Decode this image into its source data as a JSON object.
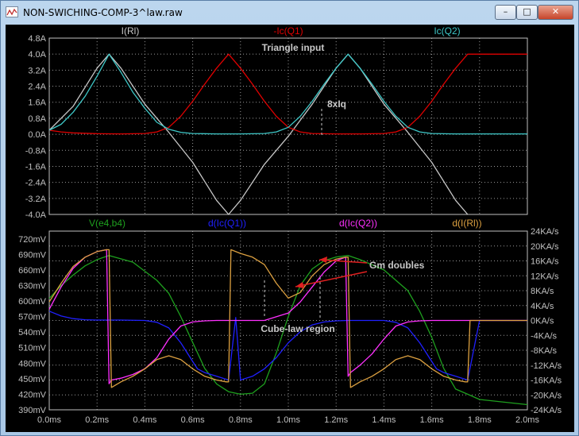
{
  "window": {
    "title": "NON-SWICHING-COMP-3^law.raw",
    "minimize": "–",
    "maximize": "□",
    "close": "✕"
  },
  "colors": {
    "white": "#c8c8c8",
    "red": "#e00000",
    "cyan": "#3ec8c8",
    "green": "#1ea01e",
    "blue": "#2020ff",
    "magenta": "#ff30ff",
    "orange": "#dca040",
    "grid": "#9a9a9a",
    "axis": "#c0c0c0"
  },
  "annotations": {
    "triangle": "Triangle input",
    "eightiq": "8xIq",
    "gm": "Gm doubles",
    "cube": "Cube-law region"
  },
  "chart_data": [
    {
      "type": "line",
      "xlim": [
        0,
        2.0
      ],
      "ylim": [
        -4.0,
        4.8
      ],
      "ytick_labels": [
        "4.8A",
        "4.0A",
        "3.2A",
        "2.4A",
        "1.6A",
        "0.8A",
        "0.0A",
        "-0.8A",
        "-1.6A",
        "-2.4A",
        "-3.2A",
        "-4.0A"
      ],
      "series": [
        {
          "name": "I(Rl)",
          "color": "white",
          "x": [
            0,
            0.1,
            0.2,
            0.25,
            0.3,
            0.4,
            0.5,
            0.6,
            0.7,
            0.75,
            0.8,
            0.9,
            1.0,
            1.1,
            1.2,
            1.25,
            1.3,
            1.4,
            1.5,
            1.6,
            1.7,
            1.75
          ],
          "y": [
            0.2,
            1.4,
            3.3,
            4.0,
            3.3,
            1.5,
            0.1,
            -1.4,
            -3.3,
            -4.0,
            -3.3,
            -1.5,
            -0.1,
            1.5,
            3.3,
            4.0,
            3.3,
            1.5,
            0.1,
            -1.4,
            -3.3,
            -4.0
          ]
        },
        {
          "name": "-Ic(Q1)",
          "color": "red",
          "x": [
            0,
            0.05,
            0.1,
            0.2,
            0.3,
            0.4,
            0.45,
            0.5,
            0.55,
            0.6,
            0.65,
            0.7,
            0.75,
            0.8,
            0.85,
            0.9,
            0.95,
            1.0,
            1.05,
            1.1,
            1.2,
            1.3,
            1.4,
            1.45,
            1.5,
            1.55,
            1.6,
            1.65,
            1.7,
            1.75,
            2.0
          ],
          "y": [
            0.2,
            0.12,
            0.07,
            0.03,
            0.02,
            0.04,
            0.12,
            0.35,
            0.9,
            1.65,
            2.5,
            3.3,
            4.0,
            3.3,
            2.5,
            1.65,
            0.9,
            0.35,
            0.12,
            0.04,
            0.02,
            0.02,
            0.04,
            0.12,
            0.35,
            0.9,
            1.65,
            2.5,
            3.3,
            4.0,
            4.0
          ]
        },
        {
          "name": "Ic(Q2)",
          "color": "cyan",
          "x": [
            0,
            0.05,
            0.1,
            0.15,
            0.2,
            0.25,
            0.3,
            0.35,
            0.4,
            0.45,
            0.5,
            0.55,
            0.6,
            0.7,
            0.8,
            0.9,
            0.95,
            1.0,
            1.05,
            1.1,
            1.15,
            1.2,
            1.25,
            1.3,
            1.35,
            1.4,
            1.45,
            1.5,
            1.55,
            1.6,
            1.7,
            2.0
          ],
          "y": [
            0.2,
            0.5,
            1.1,
            1.9,
            2.9,
            4.0,
            3.1,
            2.1,
            1.3,
            0.6,
            0.25,
            0.1,
            0.04,
            0.02,
            0.02,
            0.04,
            0.12,
            0.35,
            0.9,
            1.65,
            2.5,
            3.3,
            4.0,
            3.3,
            2.5,
            1.65,
            0.9,
            0.35,
            0.12,
            0.04,
            0.02,
            0.02
          ]
        }
      ]
    },
    {
      "type": "line",
      "xlim": [
        0,
        2.0
      ],
      "x_tick_labels": [
        "0.0ms",
        "0.2ms",
        "0.4ms",
        "0.6ms",
        "0.8ms",
        "1.0ms",
        "1.2ms",
        "1.4ms",
        "1.6ms",
        "1.8ms",
        "2.0ms"
      ],
      "ylim_left": [
        390,
        735
      ],
      "ylim_right": [
        -24,
        24
      ],
      "left_tick_labels": [
        "720mV",
        "690mV",
        "660mV",
        "630mV",
        "600mV",
        "570mV",
        "540mV",
        "510mV",
        "480mV",
        "450mV",
        "420mV",
        "390mV"
      ],
      "right_tick_labels": [
        "24KA/s",
        "20KA/s",
        "16KA/s",
        "12KA/s",
        "8KA/s",
        "4KA/s",
        "0KA/s",
        "-4KA/s",
        "-8KA/s",
        "-12KA/s",
        "-16KA/s",
        "-20KA/s",
        "-24KA/s"
      ],
      "series": [
        {
          "name": "V(e4,b4)",
          "color": "green",
          "axis": "left",
          "x": [
            0,
            0.05,
            0.1,
            0.15,
            0.2,
            0.25,
            0.35,
            0.45,
            0.5,
            0.55,
            0.6,
            0.65,
            0.7,
            0.75,
            0.8,
            0.85,
            0.9,
            0.95,
            1.0,
            1.05,
            1.1,
            1.15,
            1.2,
            1.25,
            1.3,
            1.4,
            1.5,
            1.55,
            1.6,
            1.65,
            1.7,
            1.75,
            1.8,
            2.0
          ],
          "y": [
            605,
            630,
            650,
            668,
            680,
            688,
            675,
            640,
            615,
            570,
            520,
            470,
            440,
            425,
            420,
            422,
            440,
            500,
            570,
            630,
            662,
            678,
            685,
            688,
            680,
            660,
            620,
            580,
            530,
            470,
            430,
            420,
            410,
            400
          ]
        },
        {
          "name": "d(Ic(Q1))",
          "color": "blue",
          "axis": "right",
          "x": [
            0,
            0.05,
            0.1,
            0.15,
            0.2,
            0.3,
            0.4,
            0.45,
            0.5,
            0.55,
            0.6,
            0.62,
            0.65,
            0.7,
            0.75,
            0.78,
            0.8,
            0.85,
            0.9,
            0.95,
            1.0,
            1.05,
            1.1,
            1.15,
            1.2,
            1.25,
            1.3,
            1.4,
            1.45,
            1.5,
            1.55,
            1.6,
            1.62,
            1.65,
            1.7,
            1.75,
            1.8,
            2.0
          ],
          "y": [
            2.5,
            1.2,
            0.5,
            0.2,
            0.1,
            0.1,
            0.0,
            -0.5,
            -2,
            -6,
            -11,
            -13,
            -14,
            -15,
            -16,
            0.8,
            -16,
            -15,
            -13,
            -10,
            -6,
            -3,
            -1.2,
            -0.4,
            -0.1,
            0,
            0,
            0,
            -0.5,
            -2,
            -6,
            -11,
            -13,
            -14,
            -15,
            -16,
            0,
            0
          ]
        },
        {
          "name": "d(Ic(Q2))",
          "color": "magenta",
          "axis": "right",
          "x": [
            0,
            0.05,
            0.1,
            0.15,
            0.2,
            0.24,
            0.25,
            0.26,
            0.3,
            0.35,
            0.4,
            0.45,
            0.5,
            0.55,
            0.6,
            0.65,
            0.7,
            0.74,
            0.75,
            0.8,
            0.9,
            1.0,
            1.05,
            1.1,
            1.15,
            1.2,
            1.24,
            1.25,
            1.26,
            1.3,
            1.35,
            1.4,
            1.45,
            1.5,
            1.55,
            1.6,
            1.65,
            1.7,
            1.75,
            1.8,
            2.0
          ],
          "y": [
            3,
            9,
            14,
            17,
            18.5,
            19,
            -17,
            -16,
            -15.5,
            -14.5,
            -13,
            -10,
            -5,
            -1.5,
            -0.4,
            -0.1,
            0,
            0,
            0,
            0,
            0,
            2,
            5,
            9,
            13,
            16,
            17,
            -15,
            -14,
            -12,
            -9,
            -5,
            -1.5,
            -0.4,
            -0.1,
            0,
            0,
            0,
            0,
            0,
            0
          ]
        },
        {
          "name": "d(I(Rl))",
          "color": "orange",
          "axis": "right",
          "x": [
            0,
            0.05,
            0.1,
            0.15,
            0.2,
            0.24,
            0.25,
            0.26,
            0.3,
            0.35,
            0.4,
            0.45,
            0.5,
            0.55,
            0.6,
            0.65,
            0.7,
            0.74,
            0.75,
            0.76,
            0.8,
            0.85,
            0.9,
            0.95,
            1.0,
            1.05,
            1.1,
            1.15,
            1.2,
            1.24,
            1.25,
            1.26,
            1.3,
            1.35,
            1.4,
            1.45,
            1.5,
            1.55,
            1.6,
            1.65,
            1.7,
            1.74,
            1.75,
            1.76,
            2.0
          ],
          "y": [
            5,
            10,
            14.5,
            17,
            18.5,
            19,
            19,
            -18,
            -16.5,
            -15,
            -13,
            -10.5,
            -9.5,
            -10.5,
            -13,
            -15,
            -16,
            -16.5,
            -16.5,
            19,
            18,
            17,
            15,
            10,
            6,
            7.5,
            12,
            15,
            16.5,
            17,
            17,
            -18,
            -16.5,
            -15,
            -13,
            -10.5,
            -9.5,
            -10.5,
            -13,
            -15,
            -16,
            -16.5,
            -16.5,
            0,
            0
          ]
        }
      ]
    }
  ]
}
